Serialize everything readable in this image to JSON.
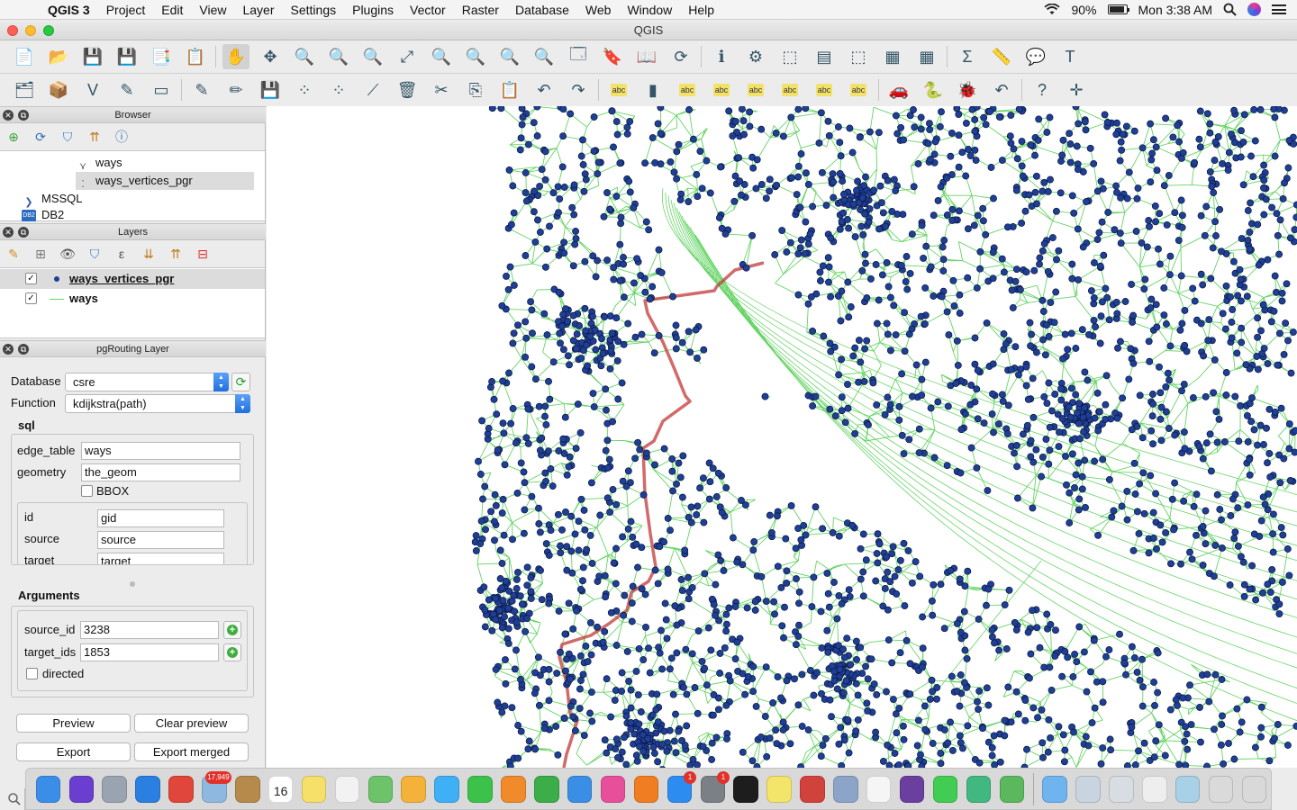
{
  "menubar": {
    "app_name": "QGIS 3",
    "items": [
      "Project",
      "Edit",
      "View",
      "Layer",
      "Settings",
      "Plugins",
      "Vector",
      "Raster",
      "Database",
      "Web",
      "Window",
      "Help"
    ],
    "battery": "90%",
    "battery_level": 0.9,
    "clock": "Mon 3:38 AM"
  },
  "window": {
    "title": "QGIS"
  },
  "toolbar1": [
    {
      "name": "new-project",
      "icon": "📄"
    },
    {
      "name": "open-project",
      "icon": "📂"
    },
    {
      "name": "save-project",
      "icon": "💾"
    },
    {
      "name": "save-as",
      "icon": "💾"
    },
    {
      "name": "new-print-layout",
      "icon": "📑"
    },
    {
      "name": "layout-manager",
      "icon": "📋"
    },
    {
      "name": "pan-map",
      "icon": "✋"
    },
    {
      "name": "pan-to-selection",
      "icon": "✥"
    },
    {
      "name": "zoom-in",
      "icon": "🔍"
    },
    {
      "name": "zoom-out",
      "icon": "🔍"
    },
    {
      "name": "zoom-native",
      "icon": "🔍"
    },
    {
      "name": "zoom-full",
      "icon": "⤢"
    },
    {
      "name": "zoom-to-selection",
      "icon": "🔍"
    },
    {
      "name": "zoom-to-layer",
      "icon": "🔍"
    },
    {
      "name": "zoom-last",
      "icon": "🔍"
    },
    {
      "name": "zoom-next",
      "icon": "🔍"
    },
    {
      "name": "new-map-view",
      "icon": "🗔"
    },
    {
      "name": "new-bookmark",
      "icon": "🔖"
    },
    {
      "name": "show-bookmarks",
      "icon": "📖"
    },
    {
      "name": "refresh",
      "icon": "⟳"
    },
    {
      "name": "identify",
      "icon": "ℹ"
    },
    {
      "name": "action",
      "icon": "⚙"
    },
    {
      "name": "select-features",
      "icon": "⬚"
    },
    {
      "name": "select-by-value",
      "icon": "▤"
    },
    {
      "name": "deselect",
      "icon": "⬚"
    },
    {
      "name": "attribute-table",
      "icon": "▦"
    },
    {
      "name": "field-calculator",
      "icon": "▦"
    },
    {
      "name": "statistics",
      "icon": "Σ"
    },
    {
      "name": "measure",
      "icon": "📏"
    },
    {
      "name": "map-tips",
      "icon": "💬"
    },
    {
      "name": "text-annotation",
      "icon": "T"
    }
  ],
  "toolbar2": [
    {
      "name": "data-source-manager",
      "icon": "🗂"
    },
    {
      "name": "new-geopackage-layer",
      "icon": "📦"
    },
    {
      "name": "digitize-vertex",
      "icon": "V"
    },
    {
      "name": "digitize-line",
      "icon": "✎"
    },
    {
      "name": "temporary-layer",
      "icon": "▭"
    },
    {
      "name": "current-edits",
      "icon": "✎"
    },
    {
      "name": "toggle-editing",
      "icon": "✏"
    },
    {
      "name": "save-layer-edits",
      "icon": "💾"
    },
    {
      "name": "add-feature",
      "icon": "⁘"
    },
    {
      "name": "move-feature",
      "icon": "⁘"
    },
    {
      "name": "vertex-tool",
      "icon": "⟋"
    },
    {
      "name": "delete-selected",
      "icon": "🗑"
    },
    {
      "name": "cut-features",
      "icon": "✂"
    },
    {
      "name": "copy-features",
      "icon": "⎘"
    },
    {
      "name": "paste-features",
      "icon": "📋"
    },
    {
      "name": "undo",
      "icon": "↶"
    },
    {
      "name": "redo",
      "icon": "↷"
    },
    {
      "name": "label-tool",
      "icon": "abc"
    },
    {
      "name": "diagram-tool",
      "icon": "▮"
    },
    {
      "name": "highlight-labels",
      "icon": "abc"
    },
    {
      "name": "pin-labels",
      "icon": "abc"
    },
    {
      "name": "show-hide-labels",
      "icon": "abc"
    },
    {
      "name": "move-label",
      "icon": "abc"
    },
    {
      "name": "rotate-label",
      "icon": "abc"
    },
    {
      "name": "change-label",
      "icon": "abc"
    },
    {
      "name": "pgrouting-plugin",
      "icon": "🚗"
    },
    {
      "name": "python-console",
      "icon": "🐍"
    },
    {
      "name": "plugin-reloader",
      "icon": "🐞"
    },
    {
      "name": "plugin-undo",
      "icon": "↶"
    },
    {
      "name": "help-contents",
      "icon": "?"
    },
    {
      "name": "coordinate-capture",
      "icon": "✛"
    }
  ],
  "browser": {
    "title": "Browser",
    "items": [
      "ways",
      "ways_vertices_pgr",
      "MSSQL",
      "DB2"
    ]
  },
  "layers": {
    "title": "Layers",
    "items": [
      "ways_vertices_pgr",
      "ways"
    ]
  },
  "pgrouting": {
    "title": "pgRouting Layer",
    "database_label": "Database",
    "database_value": "csre",
    "function_label": "Function",
    "function_value": "kdijkstra(path)",
    "sql_label": "sql",
    "edge_table_label": "edge_table",
    "edge_table_value": "ways",
    "geometry_label": "geometry",
    "geometry_value": "the_geom",
    "bbox_label": "BBOX",
    "id_label": "id",
    "id_value": "gid",
    "source_label": "source",
    "source_value": "source",
    "target_label": "target",
    "target_value": "target",
    "arguments_label": "Arguments",
    "source_id_label": "source_id",
    "source_id_value": "3238",
    "target_ids_label": "target_ids",
    "target_ids_value": "1853",
    "directed_label": "directed",
    "preview_button": "Preview",
    "clear_preview_button": "Clear preview",
    "export_button": "Export",
    "export_merged_button": "Export merged"
  },
  "dock": {
    "apps": [
      {
        "name": "finder",
        "color": "#3b8ee8"
      },
      {
        "name": "siri",
        "color": "#6a3fd0"
      },
      {
        "name": "launchpad",
        "color": "#9aa4b0"
      },
      {
        "name": "safari",
        "color": "#2a7fe0"
      },
      {
        "name": "chrome",
        "color": "#e0463a"
      },
      {
        "name": "mail-preview",
        "color": "#8fb8e0",
        "badge": "17,949"
      },
      {
        "name": "notefile",
        "color": "#b58a4a"
      },
      {
        "name": "calendar",
        "color": "#ffffff",
        "text": "16"
      },
      {
        "name": "notes",
        "color": "#f6e06a"
      },
      {
        "name": "reminders",
        "color": "#f2f2f2"
      },
      {
        "name": "maps",
        "color": "#6cc36a"
      },
      {
        "name": "photos",
        "color": "#f4b23a"
      },
      {
        "name": "messages",
        "color": "#3fb0f5"
      },
      {
        "name": "facetime",
        "color": "#3cc24a"
      },
      {
        "name": "pages",
        "color": "#f08a2a"
      },
      {
        "name": "numbers",
        "color": "#3cae49"
      },
      {
        "name": "keynote",
        "color": "#3a8ee6"
      },
      {
        "name": "itunes",
        "color": "#e84f9a"
      },
      {
        "name": "books",
        "color": "#f07d22"
      },
      {
        "name": "app-store",
        "color": "#2d8cf0",
        "badge": "1"
      },
      {
        "name": "system-preferences",
        "color": "#7b7f86",
        "badge": "1"
      },
      {
        "name": "terminal",
        "color": "#1d1d1d"
      },
      {
        "name": "stickies",
        "color": "#f3e46a"
      },
      {
        "name": "pdf-app",
        "color": "#d2423d"
      },
      {
        "name": "preview",
        "color": "#8ca4c8"
      },
      {
        "name": "textedit",
        "color": "#f5f5f5"
      },
      {
        "name": "github-desktop",
        "color": "#6b3fa0"
      },
      {
        "name": "qt-creator",
        "color": "#41cd52"
      },
      {
        "name": "atom",
        "color": "#40b880"
      },
      {
        "name": "qgis",
        "color": "#5cb85c"
      }
    ],
    "right_apps": [
      {
        "name": "folder",
        "color": "#6fb3ef"
      },
      {
        "name": "downloads-stack",
        "color": "#c8d4e0"
      },
      {
        "name": "documents-stack",
        "color": "#d8dde3"
      },
      {
        "name": "text-stack",
        "color": "#eeeeee"
      },
      {
        "name": "screenshot-stack",
        "color": "#a8d0e6"
      },
      {
        "name": "window-stack",
        "color": "#dadada"
      },
      {
        "name": "trash",
        "color": "#d9d9d9"
      }
    ]
  },
  "colors": {
    "node_fill": "#1f3f96",
    "node_stroke": "#0a1540",
    "edge": "#66d466",
    "route": "#c23a3a"
  }
}
